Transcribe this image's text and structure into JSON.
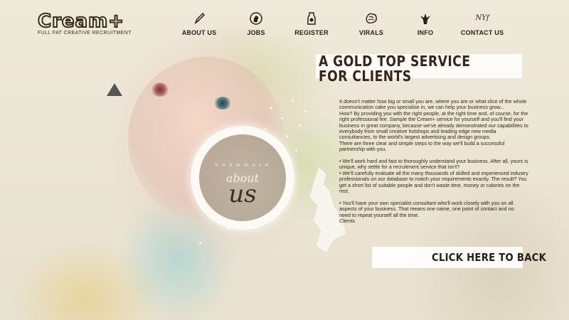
{
  "logo": {
    "text": "Cream+",
    "tagline": "FULL FAT CREATIVE RECRUITMENT"
  },
  "nav": [
    {
      "label": "ABOUT US",
      "icon": "pencil-icon"
    },
    {
      "label": "JOBS",
      "icon": "cameo-icon"
    },
    {
      "label": "REGISTER",
      "icon": "milk-bottle-icon"
    },
    {
      "label": "VIRALS",
      "icon": "brain-icon"
    },
    {
      "label": "INFO",
      "icon": "eagle-icon"
    },
    {
      "label": "CONTACT US",
      "icon": "nyf-icon",
      "icon_text": "NYf"
    }
  ],
  "circle": {
    "small_text": "k n o w  m o r e",
    "about": "about",
    "us": "us"
  },
  "headline": {
    "line1": "A GOLD TOP SERVICE",
    "line2": "FOR CLIENTS"
  },
  "body": {
    "lines": [
      "It doesn't matter how big or small you are, where you are or what slice of the whole",
      "communication cake you specialise in, we can help your business grow...",
      "How? By providing you with the right people, at the right time and, of course, for the",
      "right professional fee. Sample the Cream+ service for yourself and you'll find your",
      "business in great company, because we've already demonstrated our capabilities to",
      "everybody from small creative hotshops and leading edge new media",
      "consultancies, to the world's largest advertising and design groups.",
      "There are three clear and simple steps to the way we'll build a successful",
      "partnership with you.",
      "",
      "• We'll work hard and fast to thoroughly understand your business. After all, yours is",
      "unique, why settle for a recruitment service that isn't?",
      "• We'll carefully evaluate all the many thousands of skilled and experienced industry",
      "professionals on our database to match your requirements exactly. The result? You",
      "get a short list of suitable people and don't waste time, money or calories on the",
      "rest.",
      "",
      "• You'll have your own specialist consultant who'll work closely with you on all",
      "aspects of your business. That means one name, one point of contact and no",
      "need to repeat yourself all the time.",
      "Clients"
    ]
  },
  "back_button": {
    "label": "CLICK HERE TO BACK"
  },
  "colors": {
    "text": "#352418",
    "headline": "#3a2418",
    "background": "#ece6d6"
  }
}
